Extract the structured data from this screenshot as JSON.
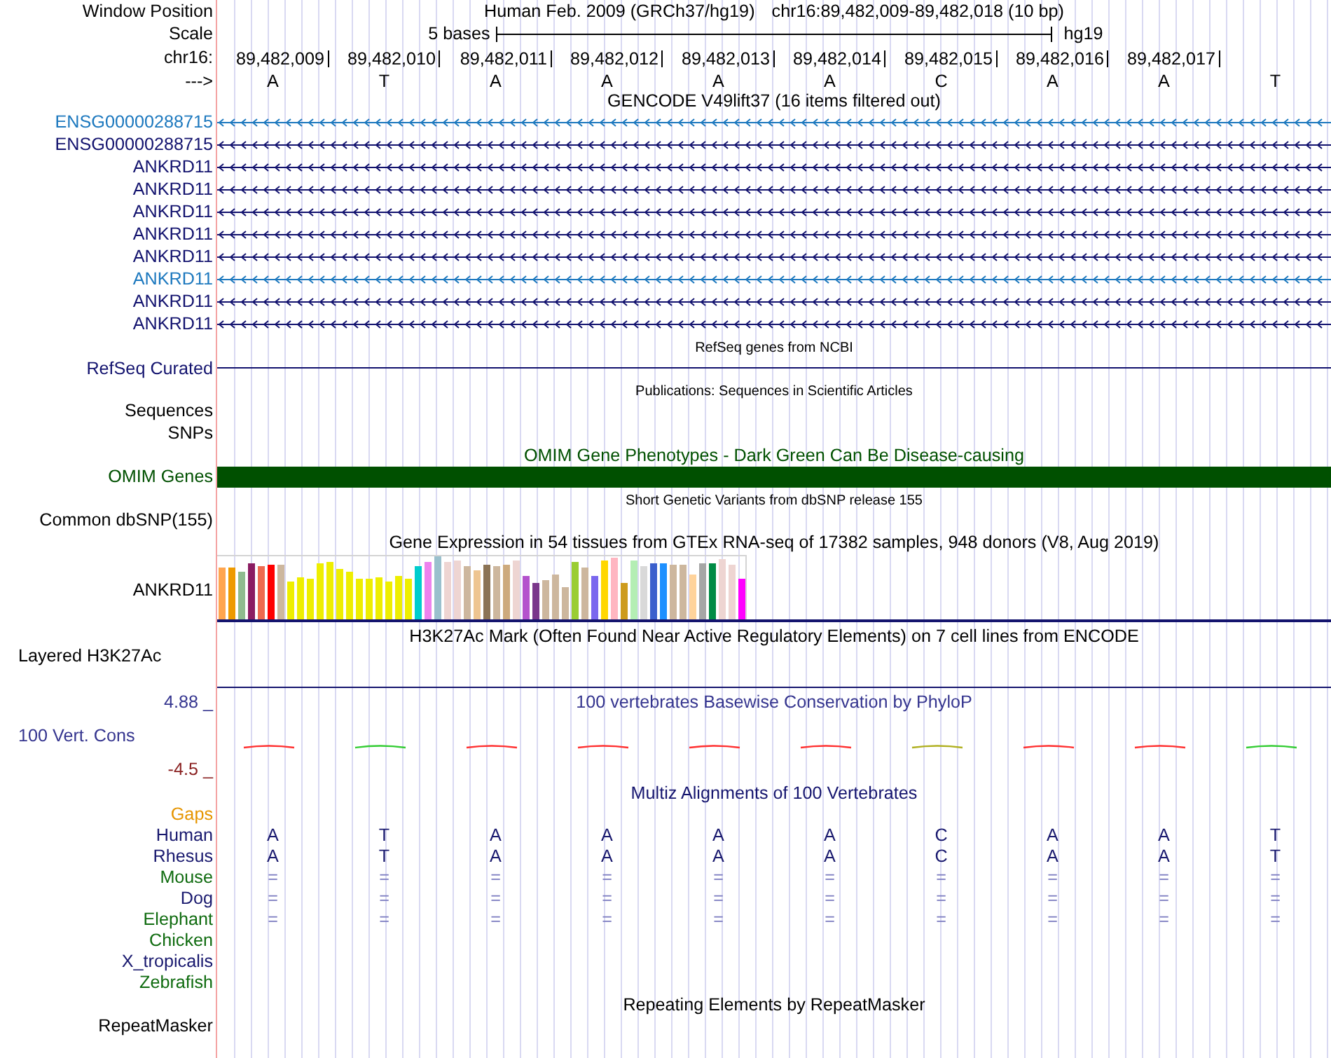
{
  "position": {
    "label": "Window Position",
    "assembly": "Human Feb. 2009 (GRCh37/hg19)",
    "range": "chr16:89,482,009-89,482,018 (10 bp)"
  },
  "scale": {
    "label": "Scale",
    "span": "5 bases",
    "assembly": "hg19"
  },
  "ruler": {
    "label": "chr16:",
    "positions": [
      "89,482,009",
      "89,482,010",
      "89,482,011",
      "89,482,012",
      "89,482,013",
      "89,482,014",
      "89,482,015",
      "89,482,016",
      "89,482,017"
    ]
  },
  "sequence": {
    "label": "--->",
    "bases": [
      "A",
      "T",
      "A",
      "A",
      "A",
      "A",
      "C",
      "A",
      "A",
      "T"
    ]
  },
  "tracks": [
    {
      "kind": "genes",
      "title": "GENCODE V49lift37 (16 items filtered out)",
      "color": "#000000",
      "items": [
        {
          "name": "ENSG00000288715",
          "color": "#1c78be"
        },
        {
          "name": "ENSG00000288715",
          "color": "#12126e"
        },
        {
          "name": "ANKRD11",
          "color": "#12126e"
        },
        {
          "name": "ANKRD11",
          "color": "#12126e"
        },
        {
          "name": "ANKRD11",
          "color": "#12126e"
        },
        {
          "name": "ANKRD11",
          "color": "#12126e"
        },
        {
          "name": "ANKRD11",
          "color": "#12126e"
        },
        {
          "name": "ANKRD11",
          "color": "#1c78be"
        },
        {
          "name": "ANKRD11",
          "color": "#12126e"
        },
        {
          "name": "ANKRD11",
          "color": "#12126e"
        }
      ]
    },
    {
      "kind": "transcripts",
      "title": "RefSeq genes from NCBI",
      "color": "#000000",
      "items": [
        {
          "name": "RefSeq Curated",
          "color": "#12126e"
        }
      ]
    },
    {
      "kind": "publications",
      "title": "Publications: Sequences in Scientific Articles",
      "color": "#000000",
      "labels": [
        "Sequences",
        "SNPs"
      ]
    },
    {
      "kind": "phenotypes",
      "title": "OMIM Gene Phenotypes - Dark Green Can Be Disease-causing",
      "color": "#005000",
      "label": "OMIM Genes"
    },
    {
      "kind": "variants",
      "title": "Short Genetic Variants from dbSNP release 155",
      "color": "#000000",
      "labels": [
        "Common dbSNP(155)"
      ]
    },
    {
      "kind": "expression",
      "title": "Gene Expression in 54 tissues from GTEx RNA-seq of 17382 samples, 948 donors (V8, Aug 2019)",
      "color": "#000000",
      "label": "ANKRD11"
    },
    {
      "kind": "regulation",
      "title": "H3K27Ac Mark (Often Found Near Active Regulatory Elements) on 7 cell lines from ENCODE",
      "color": "#000000",
      "label": "Layered H3K27Ac"
    },
    {
      "kind": "conservation",
      "title": "100 vertebrates Basewise Conservation by PhyloP",
      "color": "#35358f",
      "max": "4.88 _",
      "label": "100 Vert. Cons",
      "min": "-4.5 _"
    },
    {
      "kind": "alignment",
      "title": "Multiz Alignments of 100 Vertebrates",
      "color": "#14146e",
      "species": [
        {
          "name": "Gaps",
          "color": "#e69500"
        },
        {
          "name": "Human",
          "color": "#18186e",
          "kind": "sequence",
          "bases": [
            "A",
            "T",
            "A",
            "A",
            "A",
            "A",
            "C",
            "A",
            "A",
            "T"
          ]
        },
        {
          "name": "Rhesus",
          "color": "#18186e",
          "kind": "sequence",
          "bases": [
            "A",
            "T",
            "A",
            "A",
            "A",
            "A",
            "C",
            "A",
            "A",
            "T"
          ]
        },
        {
          "name": "Mouse",
          "color": "#0f6b0f",
          "kind": "match",
          "bases": [
            "=",
            "=",
            "=",
            "=",
            "=",
            "=",
            "=",
            "=",
            "=",
            "="
          ]
        },
        {
          "name": "Dog",
          "color": "#18186e",
          "kind": "match",
          "bases": [
            "=",
            "=",
            "=",
            "=",
            "=",
            "=",
            "=",
            "=",
            "=",
            "="
          ]
        },
        {
          "name": "Elephant",
          "color": "#0f6b0f",
          "kind": "match",
          "bases": [
            "=",
            "=",
            "=",
            "=",
            "=",
            "=",
            "=",
            "=",
            "=",
            "="
          ]
        },
        {
          "name": "Chicken",
          "color": "#0f6b0f"
        },
        {
          "name": "X_tropicalis",
          "color": "#18186e"
        },
        {
          "name": "Zebrafish",
          "color": "#0f6b0f"
        }
      ]
    },
    {
      "kind": "repeats",
      "title": "Repeating Elements by RepeatMasker",
      "color": "#000000",
      "labels": [
        "RepeatMasker"
      ]
    }
  ]
}
